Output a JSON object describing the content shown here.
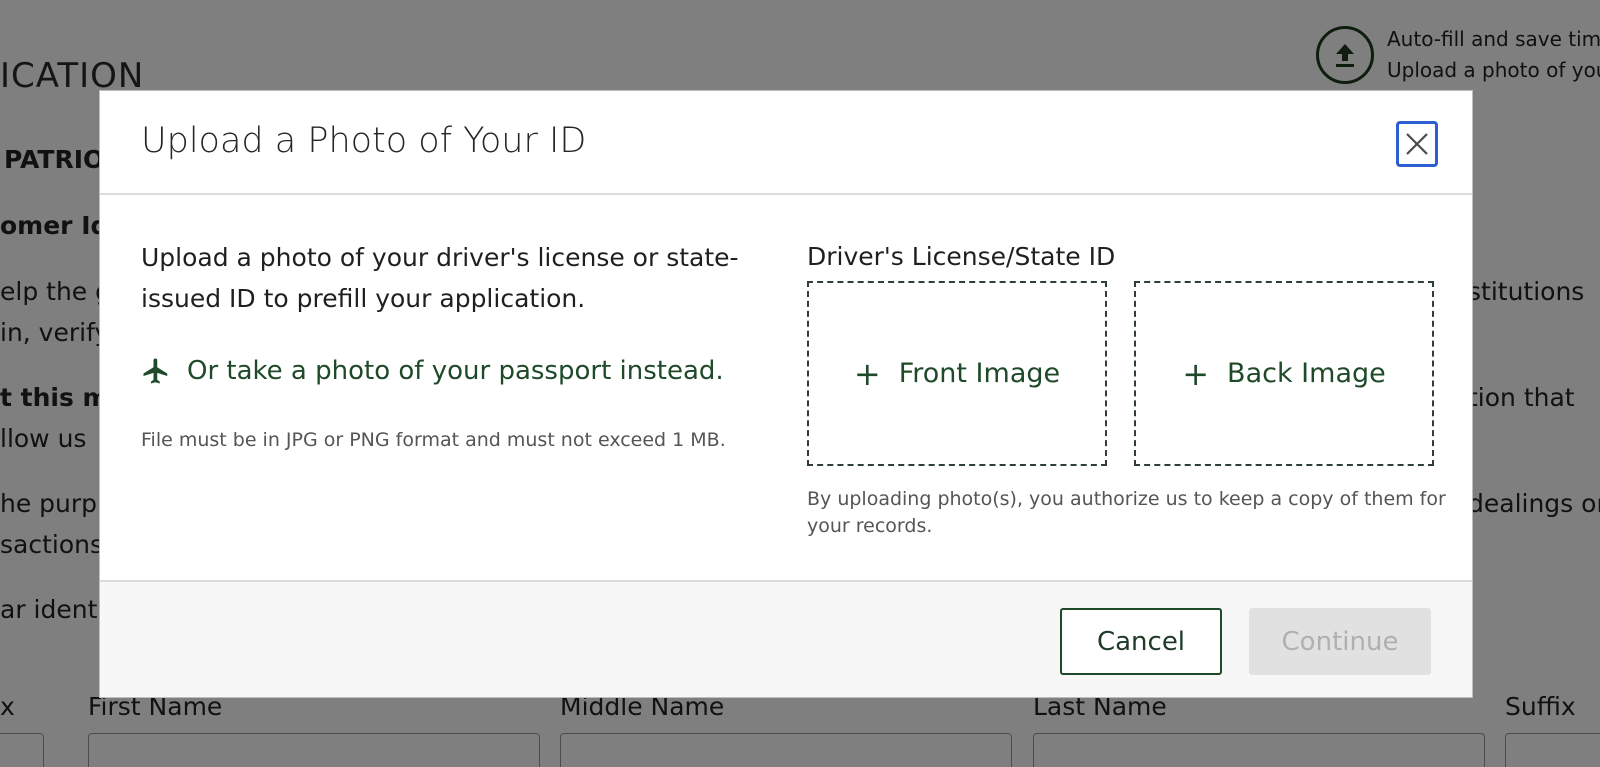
{
  "background": {
    "heading_fragment": "LICATION",
    "patriot_fragment": "PATRIO",
    "customer_fragment": "omer Id",
    "line1_left": "elp the g",
    "line1_right": "stitutions",
    "line2_left": "in, verify",
    "line3_left": "t this m",
    "line3_right": "tion that",
    "line4_left": "llow us",
    "line5_left": "he purp",
    "line5_right": "dealings or",
    "line6_left": "sactions",
    "line7_left": "ar ident",
    "autofill_line1": "Auto-fill and save time",
    "autofill_line2": "Upload a photo of you",
    "labels": {
      "prefix": "x",
      "first_name": "First Name",
      "middle_name": "Middle Name",
      "last_name": "Last Name",
      "suffix": "Suffix"
    }
  },
  "modal": {
    "title": "Upload a Photo of Your ID",
    "intro": "Upload a photo of your driver's license or state-issued ID to prefill your application.",
    "passport_link": "Or take a photo of your passport instead.",
    "file_note": "File must be in JPG or PNG format and must not exceed 1 MB.",
    "id_label": "Driver's License/State ID",
    "front_label": "Front Image",
    "back_label": "Back Image",
    "auth_note": "By uploading photo(s), you authorize us to keep a copy of them for your records.",
    "cancel_label": "Cancel",
    "continue_label": "Continue"
  },
  "colors": {
    "accent_green": "#1f4a2a",
    "focus_blue": "#2d5fd3",
    "disabled_bg": "#e1e1e1"
  }
}
